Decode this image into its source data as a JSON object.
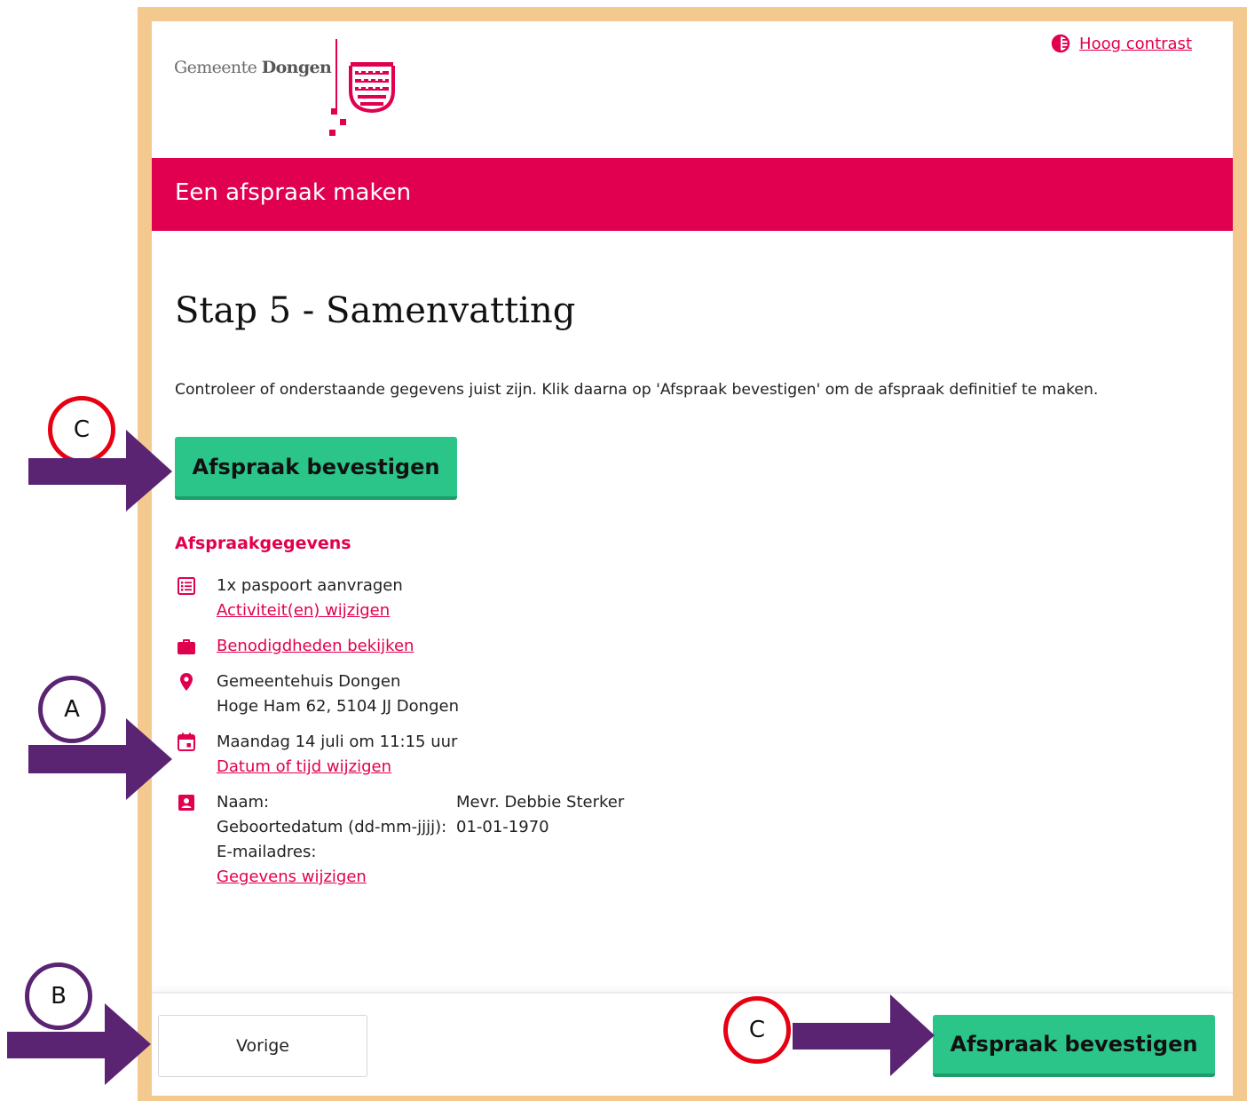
{
  "header": {
    "logo_text_regular": "Gemeente",
    "logo_text_bold": "Dongen",
    "contrast_label": "Hoog contrast"
  },
  "banner": {
    "title": "Een afspraak maken"
  },
  "main": {
    "heading": "Stap 5 - Samenvatting",
    "intro": "Controleer of onderstaande gegevens juist zijn. Klik daarna op 'Afspraak bevestigen' om de afspraak definitief te maken.",
    "confirm_label": "Afspraak bevestigen"
  },
  "details": {
    "section_title": "Afspraakgegevens",
    "activity": {
      "text": "1x paspoort aanvragen",
      "link": "Activiteit(en) wijzigen",
      "icon": "list-icon"
    },
    "requirements": {
      "link": "Benodigdheden bekijken",
      "icon": "briefcase-icon"
    },
    "location": {
      "name": "Gemeentehuis Dongen",
      "address": "Hoge Ham 62, 5104 JJ Dongen",
      "icon": "location-pin-icon"
    },
    "datetime": {
      "text": "Maandag 14 juli om 11:15 uur",
      "link": "Datum of tijd wijzigen",
      "icon": "calendar-icon"
    },
    "person": {
      "icon": "contact-card-icon",
      "name_label": "Naam:",
      "name_value": "Mevr. Debbie Sterker",
      "birth_label": "Geboortedatum (dd-mm-jjjj):",
      "birth_value": "01-01-1970",
      "email_label": "E-mailadres:",
      "email_value": "",
      "link": "Gegevens wijzigen"
    }
  },
  "footer": {
    "prev_label": "Vorige",
    "confirm_label": "Afspraak bevestigen"
  },
  "annotations": {
    "top_confirm": "C",
    "datetime": "A",
    "previous": "B",
    "bottom_confirm": "C"
  },
  "colors": {
    "brand": "#e1004f",
    "confirm": "#2bc58a",
    "frame": "#f3c98f",
    "arrow": "#5a2473",
    "circle_red": "#e60012"
  }
}
